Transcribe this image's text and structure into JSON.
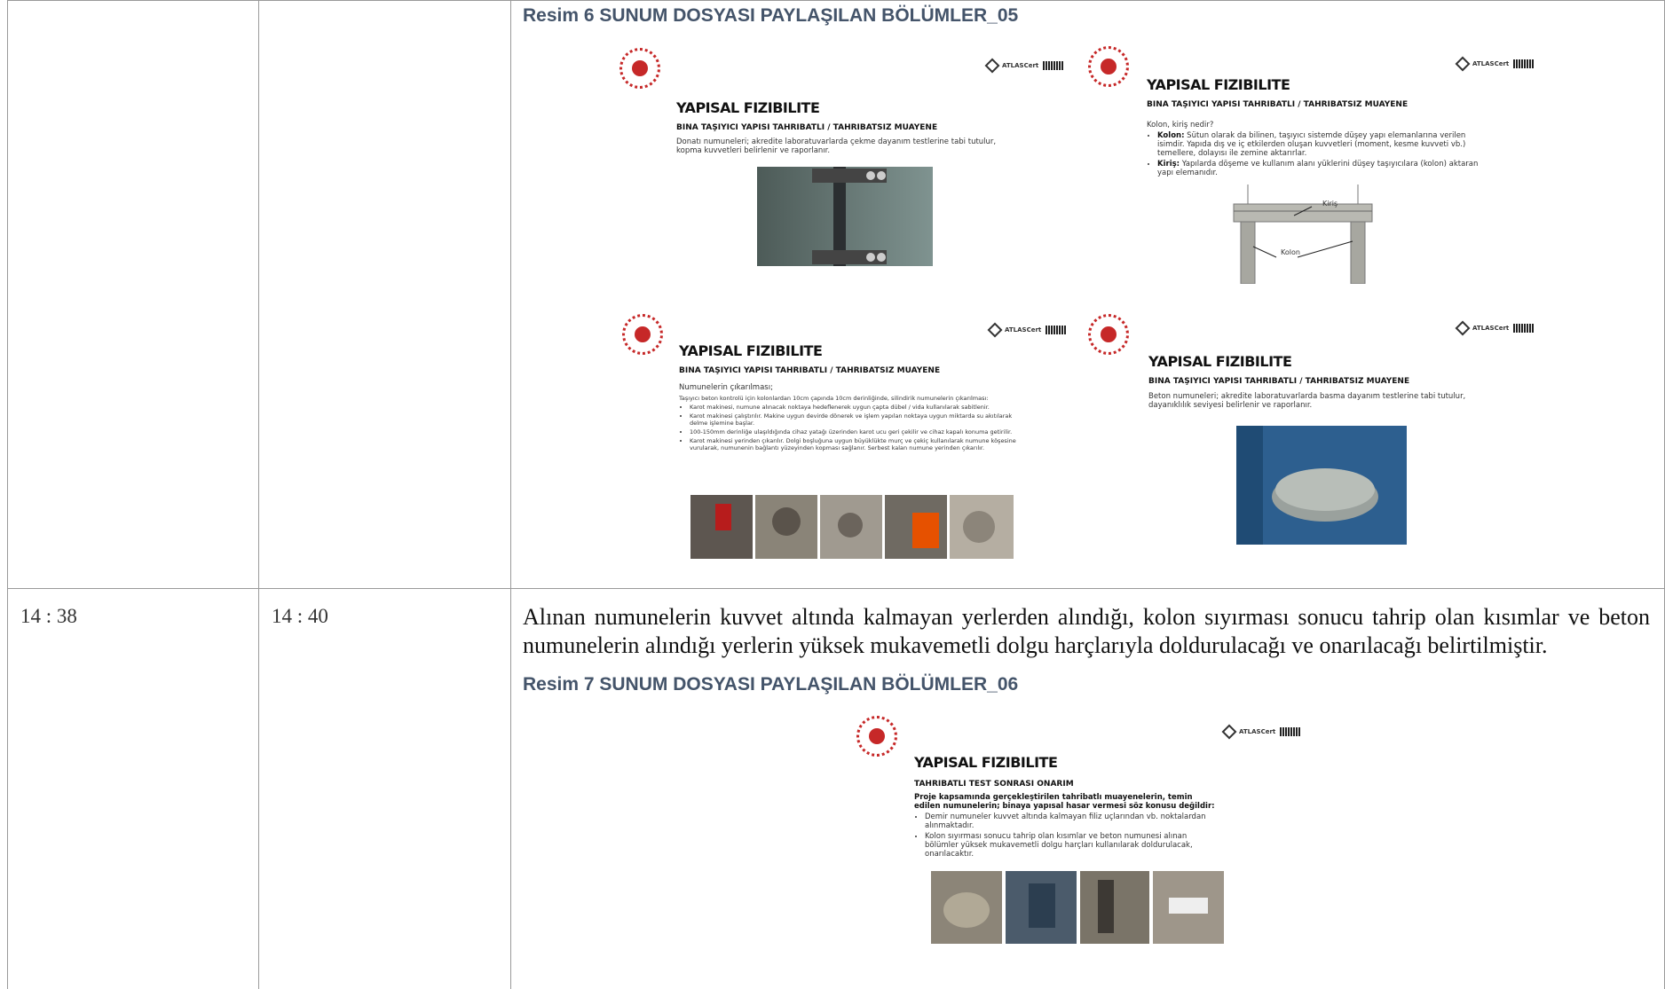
{
  "rows": [
    {
      "start": "",
      "end": "",
      "caption": "Resim 6 SUNUM DOSYASI PAYLAŞILAN BÖLÜMLER_05"
    },
    {
      "start": "14 : 38",
      "end": "14 : 40",
      "paragraph": "Alınan numunelerin kuvvet altında kalmayan yerlerden alındığı, kolon sıyırması sonucu tahrip olan kısımlar ve beton numunelerin alındığı yerlerin yüksek mukavemetli dolgu harçlarıyla doldurulacağı ve onarılacağı belirtilmiştir.",
      "caption": "Resim 7 SUNUM DOSYASI PAYLAŞILAN BÖLÜMLER_06"
    }
  ],
  "brand": "ATLASCert",
  "slides": {
    "s1": {
      "title": "YAPISAL FIZIBILITE",
      "subtitle": "BINA TAŞIYICI YAPISI TAHRIBATLI / TAHRIBATSIZ MUAYENE",
      "text": "Donatı numuneleri; akredite laboratuvarlarda çekme dayanım testlerine tabi tutulur, kopma kuvvetleri belirlenir ve raporlanır."
    },
    "s2": {
      "title": "YAPISAL FIZIBILITE",
      "subtitle": "BINA TAŞIYICI YAPISI TAHRIBATLI / TAHRIBATSIZ MUAYENE",
      "intro": "Kolon, kiriş nedir?",
      "b1_bold": "Kolon:",
      "b1": " Sütun olarak da bilinen, taşıyıcı sistemde düşey yapı elemanlarına verilen isimdir. Yapıda dış ve iç etkilerden oluşan kuvvetleri (moment, kesme kuvveti vb.) temellere, dolayısı ile zemine aktarırlar.",
      "b2_bold": "Kiriş:",
      "b2": " Yapılarda döşeme ve kullanım alanı yüklerini düşey taşıyıcılara (kolon) aktaran yapı elemanıdır.",
      "label_kiris": "Kiriş",
      "label_kolon": "Kolon"
    },
    "s3": {
      "title": "YAPISAL FIZIBILITE",
      "subtitle": "BINA TAŞIYICI YAPISI TAHRIBATLI / TAHRIBATSIZ MUAYENE",
      "intro": "Numunelerin çıkarılması;",
      "line": "Taşıyıcı beton kontrolü için kolonlardan 10cm çapında 10cm derinliğinde, silindirik numunelerin çıkarılması:",
      "b1": "Karot makinesi, numune alınacak noktaya hedeflenerek uygun çapta dübel / vida kullanılarak sabitlenir.",
      "b2": "Karot makinesi çalıştırılır. Makine uygun devirde dönerek ve işlem yapılan noktaya uygun miktarda su akıtılarak delme işlemine başlar.",
      "b3": "100-150mm derinliğe ulaşıldığında cihaz yatağı üzerinden karot ucu geri çekilir ve cihaz kapalı konuma getirilir.",
      "b4": "Karot makinesi yerinden çıkarılır. Dolgi boşluğuna uygun büyüklükte murç ve çekiç kullanılarak numune köşesine vurularak, numunenin bağlantı yüzeyinden kopması sağlanır. Serbest kalan numune yerinden çıkarılır."
    },
    "s4": {
      "title": "YAPISAL FIZIBILITE",
      "subtitle": "BINA TAŞIYICI YAPISI TAHRIBATLI / TAHRIBATSIZ MUAYENE",
      "text": "Beton numuneleri; akredite laboratuvarlarda basma dayanım testlerine tabi tutulur, dayanıklılık seviyesi belirlenir ve raporlanır."
    },
    "s5": {
      "title": "YAPISAL FIZIBILITE",
      "subtitle": "TAHRIBATLI TEST SONRASI ONARIM",
      "lead": "Proje kapsamında gerçekleştirilen tahribatlı muayenelerin, temin edilen numunelerin; binaya yapısal hasar vermesi söz konusu değildir:",
      "b1": "Demir numuneler kuvvet altında kalmayan filiz uçlarından vb. noktalardan alınmaktadır.",
      "b2": "Kolon sıyırması sonucu tahrip olan kısımlar ve beton numunesi alınan bölümler yüksek mukavemetli dolgu harçları kullanılarak doldurulacak, onarılacaktır."
    }
  }
}
